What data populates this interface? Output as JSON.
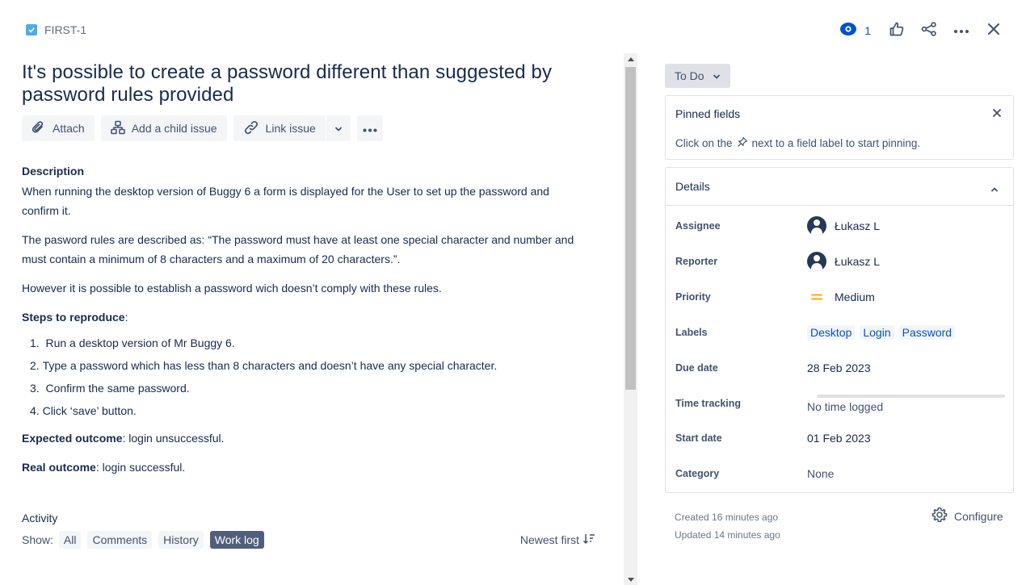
{
  "header": {
    "issue_key": "FIRST-1",
    "watch_count": "1"
  },
  "issue": {
    "title": "It's possible to create a password different than suggested by password rules provided",
    "toolbar": {
      "attach": "Attach",
      "add_child": "Add a child issue",
      "link_issue": "Link issue"
    },
    "description_title": "Description",
    "description_p1": "When running the desktop version of Buggy 6 a form is displayed for the User to set up the password and confirm it.",
    "description_p2": "The pasword rules are described as: “The password must have at least one special character and number and must contain a minimum of 8 characters and a maximum of 20 characters.”.",
    "description_p3": "However it is possible to establish a password wich doesn’t comply with these rules.",
    "steps_label": "Steps to reproduce",
    "steps": [
      {
        "num": "1.",
        "text": "Run a desktop version of Mr Buggy 6."
      },
      {
        "num": "2.",
        "text": "Type a password which has less than 8 characters and doesn’t have any special character."
      },
      {
        "num": "3.",
        "text": "Confirm the same password."
      },
      {
        "num": "4.",
        "text": "Click ‘save’ button."
      }
    ],
    "expected_label": "Expected outcome",
    "expected_text": ": login unsuccessful.",
    "real_label": "Real outcome",
    "real_text": ": login successful."
  },
  "activity": {
    "title": "Activity",
    "show_label": "Show:",
    "filters": [
      "All",
      "Comments",
      "History",
      "Work log"
    ],
    "active_filter": "Work log",
    "sort_label": "Newest first"
  },
  "sidebar": {
    "status": "To Do",
    "pinned_title": "Pinned fields",
    "pinned_hint_before": "Click on the",
    "pinned_hint_after": "next to a field label to start pinning.",
    "details_title": "Details",
    "fields": {
      "assignee_label": "Assignee",
      "assignee_value": "Łukasz L",
      "reporter_label": "Reporter",
      "reporter_value": "Łukasz L",
      "priority_label": "Priority",
      "priority_value": "Medium",
      "labels_label": "Labels",
      "labels": [
        "Desktop",
        "Login",
        "Password"
      ],
      "due_label": "Due date",
      "due_value": "28 Feb 2023",
      "time_label": "Time tracking",
      "time_value": "No time logged",
      "start_label": "Start date",
      "start_value": "01 Feb 2023",
      "category_label": "Category",
      "category_value": "None"
    },
    "created": "Created 16 minutes ago",
    "updated": "Updated 14 minutes ago",
    "configure": "Configure"
  },
  "colors": {
    "accent": "#0052cc",
    "text": "#172b4d",
    "subtle": "#42526e",
    "priority_medium": "#ffab00"
  }
}
